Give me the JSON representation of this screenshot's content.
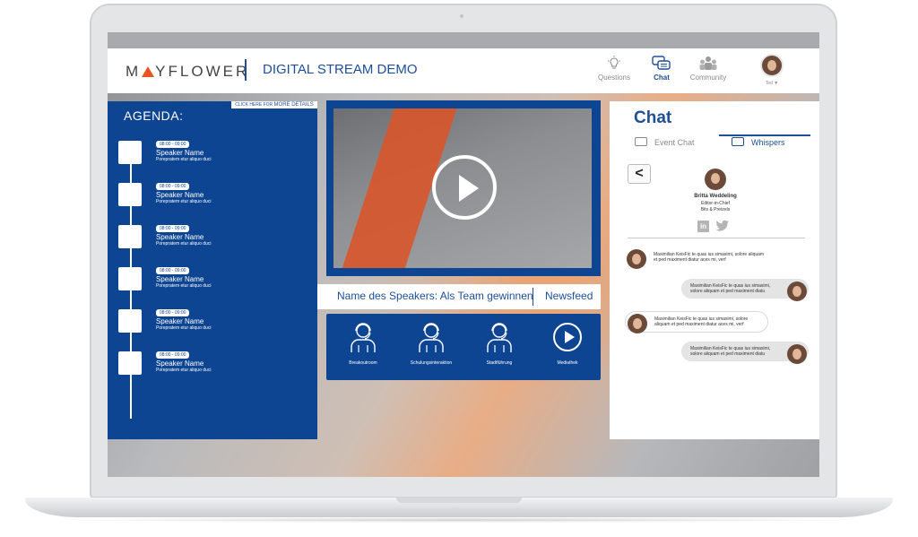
{
  "header": {
    "logo": "MAYFLOWER",
    "title": "DIGITAL STREAM DEMO",
    "nav": [
      {
        "label": "Questions",
        "icon": "lightbulb-icon"
      },
      {
        "label": "Chat",
        "icon": "chat-icon"
      },
      {
        "label": "Community",
        "icon": "community-icon"
      }
    ],
    "user_label": "Ted ▼"
  },
  "agenda": {
    "title": "AGENDA:",
    "details_prefix": "CLICK HERE FOR",
    "details_link": "MORE DETAILS",
    "items": [
      {
        "time": "08:00 - 09:00",
        "speaker": "Speaker Name",
        "desc": "Porepratem etur aliquo duci"
      },
      {
        "time": "08:00 - 09:00",
        "speaker": "Speaker Name",
        "desc": "Porepratem etur aliquo duci"
      },
      {
        "time": "08:00 - 09:00",
        "speaker": "Speaker Name",
        "desc": "Porepratem etur aliquo duci"
      },
      {
        "time": "08:00 - 09:00",
        "speaker": "Speaker Name",
        "desc": "Porepratem etur aliquo duci"
      },
      {
        "time": "08:00 - 09:00",
        "speaker": "Speaker Name",
        "desc": "Porepratem etur aliquo duci"
      },
      {
        "time": "08:00 - 09:00",
        "speaker": "Speaker Name",
        "desc": "Porepratem etur aliquo duci"
      }
    ]
  },
  "video": {
    "speaker_title": "Name des Speakers: Als Team gewinnen",
    "newsfeed": "Newsfeed"
  },
  "tiles": [
    {
      "label": "Breakoutroom",
      "icon": "person-headset-icon"
    },
    {
      "label": "Schulungsinteraktion",
      "icon": "person-headset-icon"
    },
    {
      "label": "Stadtführung",
      "icon": "person-headset-icon"
    },
    {
      "label": "Mediathek",
      "icon": "play-circle-icon"
    }
  ],
  "chat": {
    "title": "Chat",
    "tabs": [
      {
        "label": "Event Chat",
        "icon": "chat-bubbles-icon"
      },
      {
        "label": "Whispers",
        "icon": "chat-bubbles-icon"
      }
    ],
    "back": "<",
    "profile": {
      "name": "Britta Weddeling",
      "role": "Editor-in-Chief",
      "company": "Bits & Pretzels"
    },
    "messages": [
      {
        "direction": "in",
        "text": "Maximilian KeisFic te quas ius simaximi, solore aliquam et ped maximent diatur aces mi, verf"
      },
      {
        "direction": "out",
        "text": "Maximilian KeisFic te quas ius simaximi, solore aliquam et ped maximent diatu"
      },
      {
        "direction": "in",
        "text": "Maximilian KeisFic te quas ius simaximi, solore aliquam et ped maximent diatur aces mi, verf"
      },
      {
        "direction": "out",
        "text": "Maximilian KeisFic te quas ius simaximi, solore aliquam et ped maximent diatu"
      }
    ]
  },
  "colors": {
    "brand_blue": "#0d4592",
    "accent_orange": "#e8541e",
    "text_blue": "#1e4f97"
  }
}
